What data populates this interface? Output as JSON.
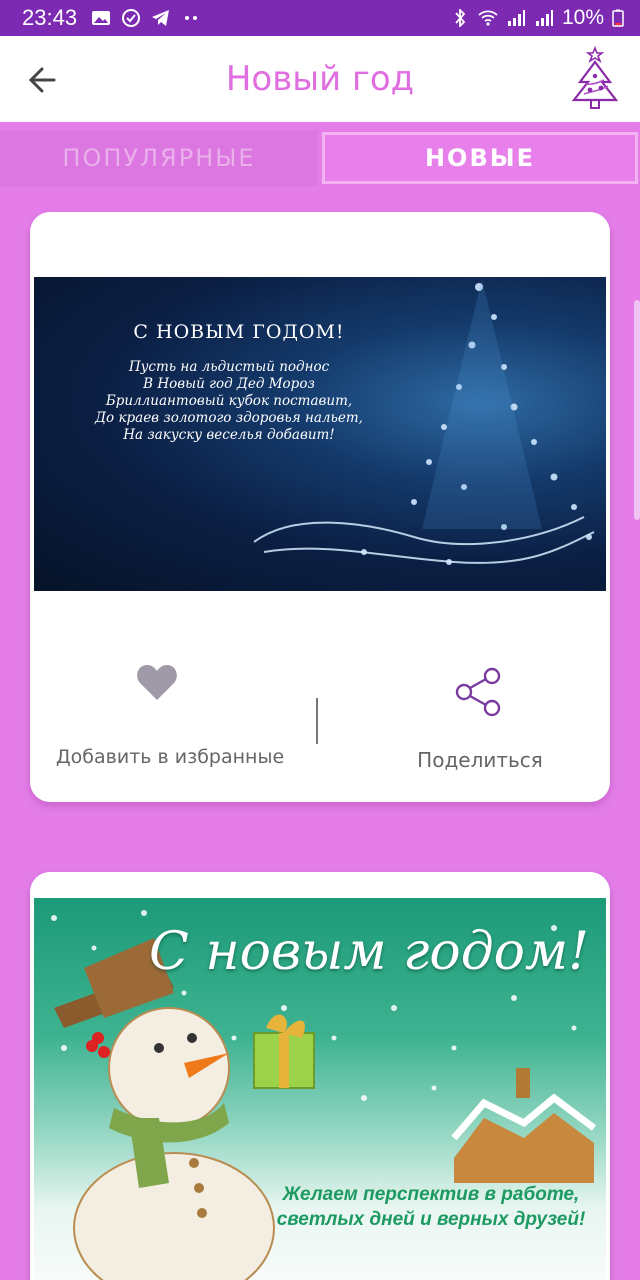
{
  "status_bar": {
    "time": "23:43",
    "battery": "10%",
    "left_icons": [
      "gallery-icon",
      "check-circle-icon",
      "telegram-icon",
      "more-dots-icon"
    ],
    "right_icons": [
      "bluetooth-icon",
      "wifi-icon",
      "signal-icon",
      "signal-icon",
      "battery-icon"
    ]
  },
  "app_bar": {
    "title": "Новый год",
    "back_icon": "arrow-left-icon",
    "logo_icon": "christmas-tree-icon",
    "accent": "#e06ee0"
  },
  "tabs": [
    {
      "label": "ПОПУЛЯРНЫЕ",
      "selected": false
    },
    {
      "label": "НОВЫЕ",
      "selected": true
    }
  ],
  "cards": [
    {
      "image": {
        "title": "С НОВЫМ ГОДОМ!",
        "poem": [
          "Пусть на льдистый поднос",
          "В Новый год Дед Мороз",
          "Бриллиантовый кубок поставит,",
          "До краев золотого здоровья нальет,",
          "На закуску веселья добавит!"
        ]
      },
      "actions": {
        "favorite_label": "Добавить в избранные",
        "favorite_icon": "heart-icon",
        "share_label": "Поделиться",
        "share_icon": "share-icon"
      }
    },
    {
      "image": {
        "headline": "С новым годом!",
        "wish_lines": [
          "Желаем перспектив в работе,",
          "светлых дней и верных друзей!"
        ]
      }
    }
  ],
  "colors": {
    "background": "#e47de8",
    "status_bar": "#7d2ab3",
    "tab_selected_text": "#ffffff",
    "tab_unselected_text": "#eab0ec"
  }
}
